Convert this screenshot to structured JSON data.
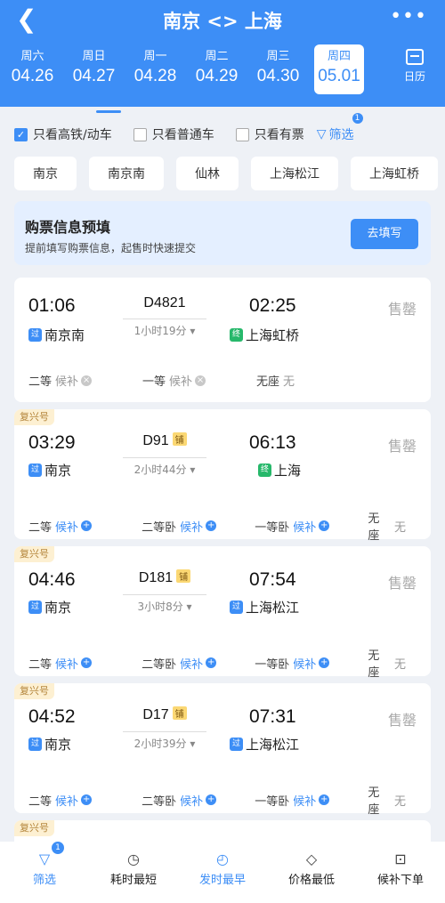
{
  "header": {
    "title": "南京 <> 上海",
    "calendar_label": "日历",
    "dates": [
      {
        "week": "周六",
        "date": "04.26"
      },
      {
        "week": "周日",
        "date": "04.27"
      },
      {
        "week": "周一",
        "date": "04.28"
      },
      {
        "week": "周二",
        "date": "04.29"
      },
      {
        "week": "周三",
        "date": "04.30"
      },
      {
        "week": "周四",
        "date": "05.01"
      }
    ]
  },
  "filters": {
    "high_speed": "只看高铁/动车",
    "normal": "只看普通车",
    "available": "只看有票",
    "filter_label": "筛选",
    "filter_badge": "1"
  },
  "stations": [
    "南京",
    "南京南",
    "仙林",
    "上海松江",
    "上海虹桥"
  ],
  "prefill": {
    "title": "购票信息预填",
    "subtitle": "提前填写购票信息，起售时快速提交",
    "button": "去填写"
  },
  "trains": [
    {
      "tag": "",
      "dep_time": "01:06",
      "number": "D4821",
      "berth": "",
      "arr_time": "02:25",
      "duration": "1小时19分",
      "from": "南京南",
      "from_mark": "过",
      "to": "上海虹桥",
      "to_mark": "终",
      "status": "售罄",
      "seats": [
        {
          "name": "二等",
          "value": "候补",
          "plus": "x"
        },
        {
          "name": "一等",
          "value": "候补",
          "plus": "x"
        },
        {
          "name": "无座",
          "value": "无",
          "plus": ""
        }
      ]
    },
    {
      "tag": "复兴号",
      "dep_time": "03:29",
      "number": "D91",
      "berth": "铺",
      "arr_time": "06:13",
      "duration": "2小时44分",
      "from": "南京",
      "from_mark": "过",
      "to": "上海",
      "to_mark": "终",
      "status": "售罄",
      "seats": [
        {
          "name": "二等",
          "value": "候补",
          "plus": "+"
        },
        {
          "name": "二等卧",
          "value": "候补",
          "plus": "+"
        },
        {
          "name": "一等卧",
          "value": "候补",
          "plus": "+"
        },
        {
          "name": "无座",
          "value": "无",
          "plus": ""
        }
      ]
    },
    {
      "tag": "复兴号",
      "dep_time": "04:46",
      "number": "D181",
      "berth": "铺",
      "arr_time": "07:54",
      "duration": "3小时8分",
      "from": "南京",
      "from_mark": "过",
      "to": "上海松江",
      "to_mark": "过",
      "status": "售罄",
      "seats": [
        {
          "name": "二等",
          "value": "候补",
          "plus": "+"
        },
        {
          "name": "二等卧",
          "value": "候补",
          "plus": "+"
        },
        {
          "name": "一等卧",
          "value": "候补",
          "plus": "+"
        },
        {
          "name": "无座",
          "value": "无",
          "plus": ""
        }
      ]
    },
    {
      "tag": "复兴号",
      "dep_time": "04:52",
      "number": "D17",
      "berth": "铺",
      "arr_time": "07:31",
      "duration": "2小时39分",
      "from": "南京",
      "from_mark": "过",
      "to": "上海松江",
      "to_mark": "过",
      "status": "售罄",
      "seats": [
        {
          "name": "二等",
          "value": "候补",
          "plus": "+"
        },
        {
          "name": "二等卧",
          "value": "候补",
          "plus": "+"
        },
        {
          "name": "一等卧",
          "value": "候补",
          "plus": "+"
        },
        {
          "name": "无座",
          "value": "无",
          "plus": ""
        }
      ]
    },
    {
      "tag": "复兴号"
    }
  ],
  "tabbar": [
    {
      "label": "筛选",
      "badge": "1",
      "icon": "filter-icon"
    },
    {
      "label": "耗时最短",
      "icon": "clock-icon"
    },
    {
      "label": "发时最早",
      "icon": "24h-icon"
    },
    {
      "label": "价格最低",
      "icon": "price-tag-icon"
    },
    {
      "label": "候补下单",
      "icon": "cart-icon"
    }
  ],
  "colors": {
    "primary": "#3d8ef6",
    "tag_bg": "#fdf0d2",
    "berth": "#fbd874"
  }
}
